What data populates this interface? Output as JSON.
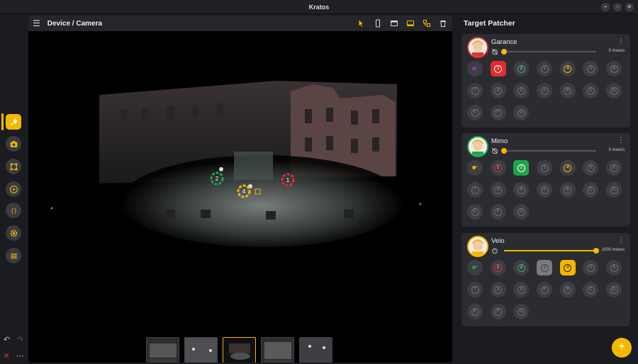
{
  "window": {
    "title": "Kratos"
  },
  "panel": {
    "title": "Device / Camera"
  },
  "patcher": {
    "title": "Target Patcher"
  },
  "targets": [
    {
      "name": "Garance",
      "delay": "0 msecs",
      "delay_fraction": 0.0,
      "accent": "#e0312f",
      "hand_color": "#a02cc7",
      "buttons": [
        {
          "label": "1",
          "state": "red-active"
        },
        {
          "label": "2",
          "state": "green-ring"
        },
        {
          "label": "3",
          "state": "off"
        },
        {
          "label": "4",
          "state": "yellow-ring"
        },
        {
          "label": "5",
          "state": "off"
        },
        {
          "label": "6",
          "state": "off"
        },
        {
          "label": "7",
          "state": "off"
        },
        {
          "label": "8",
          "state": "off"
        },
        {
          "label": "9",
          "state": "off"
        },
        {
          "label": "A",
          "state": "off"
        },
        {
          "label": "B",
          "state": "off"
        },
        {
          "label": "C",
          "state": "off"
        },
        {
          "label": "D",
          "state": "off"
        },
        {
          "label": "E",
          "state": "off"
        },
        {
          "label": "F",
          "state": "off"
        },
        {
          "label": "G",
          "state": "off"
        }
      ]
    },
    {
      "name": "Mimo",
      "delay": "0 msecs",
      "delay_fraction": 0.0,
      "accent": "#1fa54a",
      "hand_color": "#f5b800",
      "buttons": [
        {
          "label": "1",
          "state": "red-ring"
        },
        {
          "label": "2",
          "state": "green-active"
        },
        {
          "label": "3",
          "state": "off"
        },
        {
          "label": "4",
          "state": "yellow-ring"
        },
        {
          "label": "5",
          "state": "off"
        },
        {
          "label": "6",
          "state": "off"
        },
        {
          "label": "7",
          "state": "off"
        },
        {
          "label": "8",
          "state": "off"
        },
        {
          "label": "9",
          "state": "off"
        },
        {
          "label": "A",
          "state": "off"
        },
        {
          "label": "B",
          "state": "off"
        },
        {
          "label": "C",
          "state": "off"
        },
        {
          "label": "D",
          "state": "off"
        },
        {
          "label": "E",
          "state": "off"
        },
        {
          "label": "F",
          "state": "off"
        },
        {
          "label": "G",
          "state": "off"
        }
      ]
    },
    {
      "name": "Velo",
      "delay": "1000 msecs",
      "delay_fraction": 1.0,
      "accent": "#f5b800",
      "hand_color": "#1fa54a",
      "buttons": [
        {
          "label": "1",
          "state": "red-ring"
        },
        {
          "label": "2",
          "state": "green-ring"
        },
        {
          "label": "3",
          "state": "gray-active"
        },
        {
          "label": "4",
          "state": "yellow-active"
        },
        {
          "label": "5",
          "state": "off"
        },
        {
          "label": "6",
          "state": "off"
        },
        {
          "label": "7",
          "state": "off"
        },
        {
          "label": "8",
          "state": "off"
        },
        {
          "label": "9",
          "state": "off"
        },
        {
          "label": "A",
          "state": "off"
        },
        {
          "label": "B",
          "state": "off"
        },
        {
          "label": "C",
          "state": "off"
        },
        {
          "label": "D",
          "state": "off"
        },
        {
          "label": "E",
          "state": "off"
        },
        {
          "label": "F",
          "state": "off"
        },
        {
          "label": "G",
          "state": "off"
        }
      ]
    }
  ],
  "markers": [
    {
      "label": "2",
      "color": "#1fa54a"
    },
    {
      "label": "1",
      "color": "#e32c2c"
    },
    {
      "label": "4",
      "color": "#f5b800"
    }
  ],
  "icons": {
    "sidebar": [
      "rocket-icon",
      "camera-icon",
      "shape-icon",
      "play-icon",
      "code-braces-icon",
      "gear-icon",
      "menu-icon"
    ],
    "toolbar": [
      "pointer-icon",
      "phone-icon",
      "window-icon",
      "window-bottom-icon",
      "layout-icon",
      "trash-icon"
    ]
  },
  "colors": {
    "accent": "#f5b800",
    "background": "#1b1c20",
    "card": "#2b2c31"
  }
}
